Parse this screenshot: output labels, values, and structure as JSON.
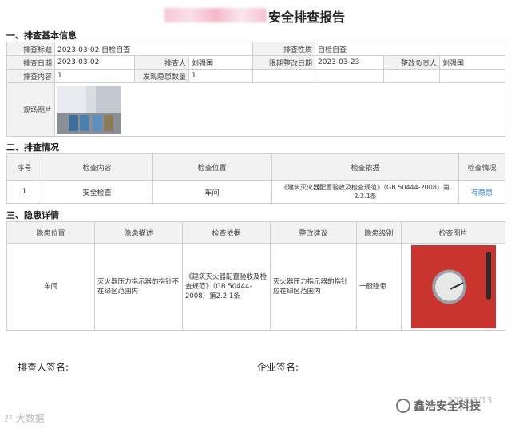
{
  "title": {
    "suffix": "安全排查报告"
  },
  "sections": {
    "basic": "一、排查基本信息",
    "check": "二、排查情况",
    "hazard": "三、隐患详情"
  },
  "basic": {
    "title_label": "排查标题",
    "title_value": "2023-03-02 自检自查",
    "nature_label": "排查性质",
    "nature_value": "自检自查",
    "date_label": "排查日期",
    "date_value": "2023-03-02",
    "inspector_label": "排查人",
    "inspector_value": "刘强国",
    "deadline_label": "限期整改日期",
    "deadline_value": "2023-03-23",
    "owner_label": "整改负责人",
    "owner_value": "刘强国",
    "content_label": "排查内容",
    "content_value": "1",
    "count_label": "发现隐患数量",
    "count_value": "1",
    "photo_label": "现场图片"
  },
  "check": {
    "headers": [
      "序号",
      "检查内容",
      "检查位置",
      "检查依据",
      "检查情况"
    ],
    "row": {
      "no": "1",
      "content": "安全检查",
      "location": "车间",
      "basis": "《建筑灭火器配置验收及检查规范》（GB 50444-2008）第2.2.1条",
      "status": "有隐患"
    }
  },
  "hazard": {
    "headers": [
      "隐患位置",
      "隐患描述",
      "检查依据",
      "整改建议",
      "隐患级别",
      "检查图片"
    ],
    "row": {
      "location": "车间",
      "description": "灭火器压力指示器的指针不在绿区范围内",
      "basis": "《建筑灭火器配置验收及检查规范》（GB 50444-2008）第2.2.1条",
      "suggestion": "灭火器压力指示器的指针应在绿区范围内",
      "level": "一般隐患"
    }
  },
  "signatures": {
    "inspector": "排查人签名:",
    "company": "企业签名:"
  },
  "footer": {
    "left_watermark": "ℓ² 大数据",
    "date": "2023/3/13",
    "brand": "鑫浩安全科技"
  }
}
